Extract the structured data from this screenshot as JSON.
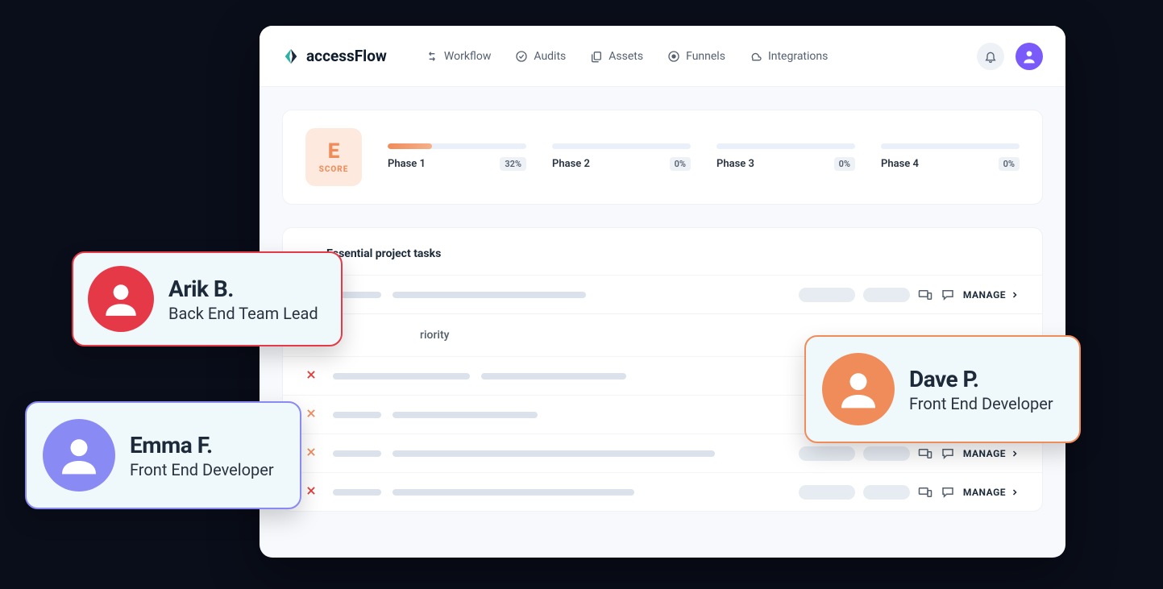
{
  "brand": "accessFlow",
  "nav": {
    "workflow": "Workflow",
    "audits": "Audits",
    "assets": "Assets",
    "funnels": "Funnels",
    "integrations": "Integrations"
  },
  "score": {
    "grade": "E",
    "label": "SCORE"
  },
  "phases": [
    {
      "label": "Phase 1",
      "pct": "32%"
    },
    {
      "label": "Phase 2",
      "pct": "0%"
    },
    {
      "label": "Phase 3",
      "pct": "0%"
    },
    {
      "label": "Phase 4",
      "pct": "0%"
    }
  ],
  "sections": {
    "essential": "Essential project tasks",
    "priority": "riority"
  },
  "manage_label": "MANAGE",
  "people": {
    "arik": {
      "name": "Arik B.",
      "role": "Back End Team Lead"
    },
    "emma": {
      "name": "Emma F.",
      "role": "Front End Developer"
    },
    "dave": {
      "name": "Dave P.",
      "role": "Front End Developer"
    }
  }
}
